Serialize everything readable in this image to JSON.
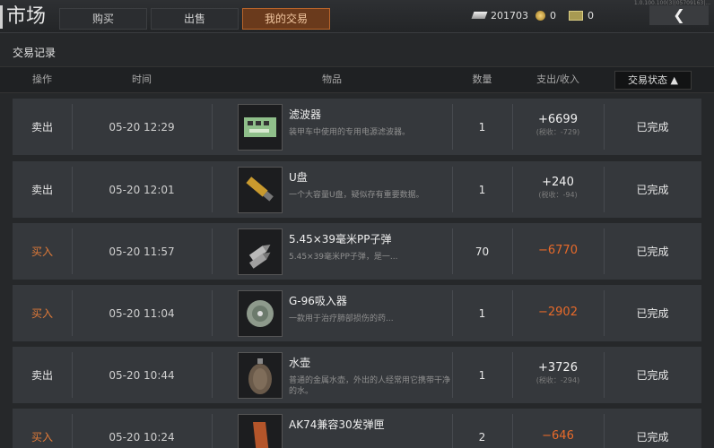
{
  "header": {
    "title": "市场",
    "tabs": [
      {
        "label": "购买",
        "active": false
      },
      {
        "label": "出售",
        "active": false
      },
      {
        "label": "我的交易",
        "active": true
      }
    ],
    "currencies": [
      {
        "icon": "silver-bar-icon",
        "value": "201703"
      },
      {
        "icon": "gold-coin-icon",
        "value": "0"
      },
      {
        "icon": "banknote-icon",
        "value": "0"
      }
    ],
    "back_icon": "back-arrow-icon",
    "debug_text": "1.0.100.100(3)|05709163|..."
  },
  "section_title": "交易记录",
  "columns": {
    "op": "操作",
    "time": "时间",
    "item": "物品",
    "qty": "数量",
    "amount": "支出/收入",
    "status_filter": "交易状态"
  },
  "rows": [
    {
      "op": "卖出",
      "type": "sell",
      "time": "05-20 12:29",
      "name": "滤波器",
      "desc": "装甲车中使用的专用电源滤波器。",
      "qty": "1",
      "amount": "+6699",
      "fee": "(税收：-729)",
      "status": "已完成",
      "icon": "circuit-board-icon"
    },
    {
      "op": "卖出",
      "type": "sell",
      "time": "05-20 12:01",
      "name": "U盘",
      "desc": "一个大容量U盘，疑似存有重要数据。",
      "qty": "1",
      "amount": "+240",
      "fee": "(税收：-94)",
      "status": "已完成",
      "icon": "usb-drive-icon"
    },
    {
      "op": "买入",
      "type": "buy",
      "time": "05-20 11:57",
      "name": "5.45×39毫米PP子弹",
      "desc": "5.45×39毫米PP子弹，是一...",
      "qty": "70",
      "amount": "−6770",
      "fee": "",
      "status": "已完成",
      "icon": "bullet-icon"
    },
    {
      "op": "买入",
      "type": "buy",
      "time": "05-20 11:04",
      "name": "G-96吸入器",
      "desc": "一款用于治疗肺部损伤的药...",
      "qty": "1",
      "amount": "−2902",
      "fee": "",
      "status": "已完成",
      "icon": "inhaler-icon"
    },
    {
      "op": "卖出",
      "type": "sell",
      "time": "05-20 10:44",
      "name": "水壶",
      "desc": "普通的金属水壶，外出的人经常用它携带干净的水。",
      "qty": "1",
      "amount": "+3726",
      "fee": "(税收：-294)",
      "status": "已完成",
      "icon": "canteen-icon"
    },
    {
      "op": "买入",
      "type": "buy",
      "time": "05-20 10:24",
      "name": "AK74兼容30发弹匣",
      "desc": "",
      "qty": "2",
      "amount": "−646",
      "fee": "",
      "status": "已完成",
      "icon": "magazine-icon"
    }
  ]
}
